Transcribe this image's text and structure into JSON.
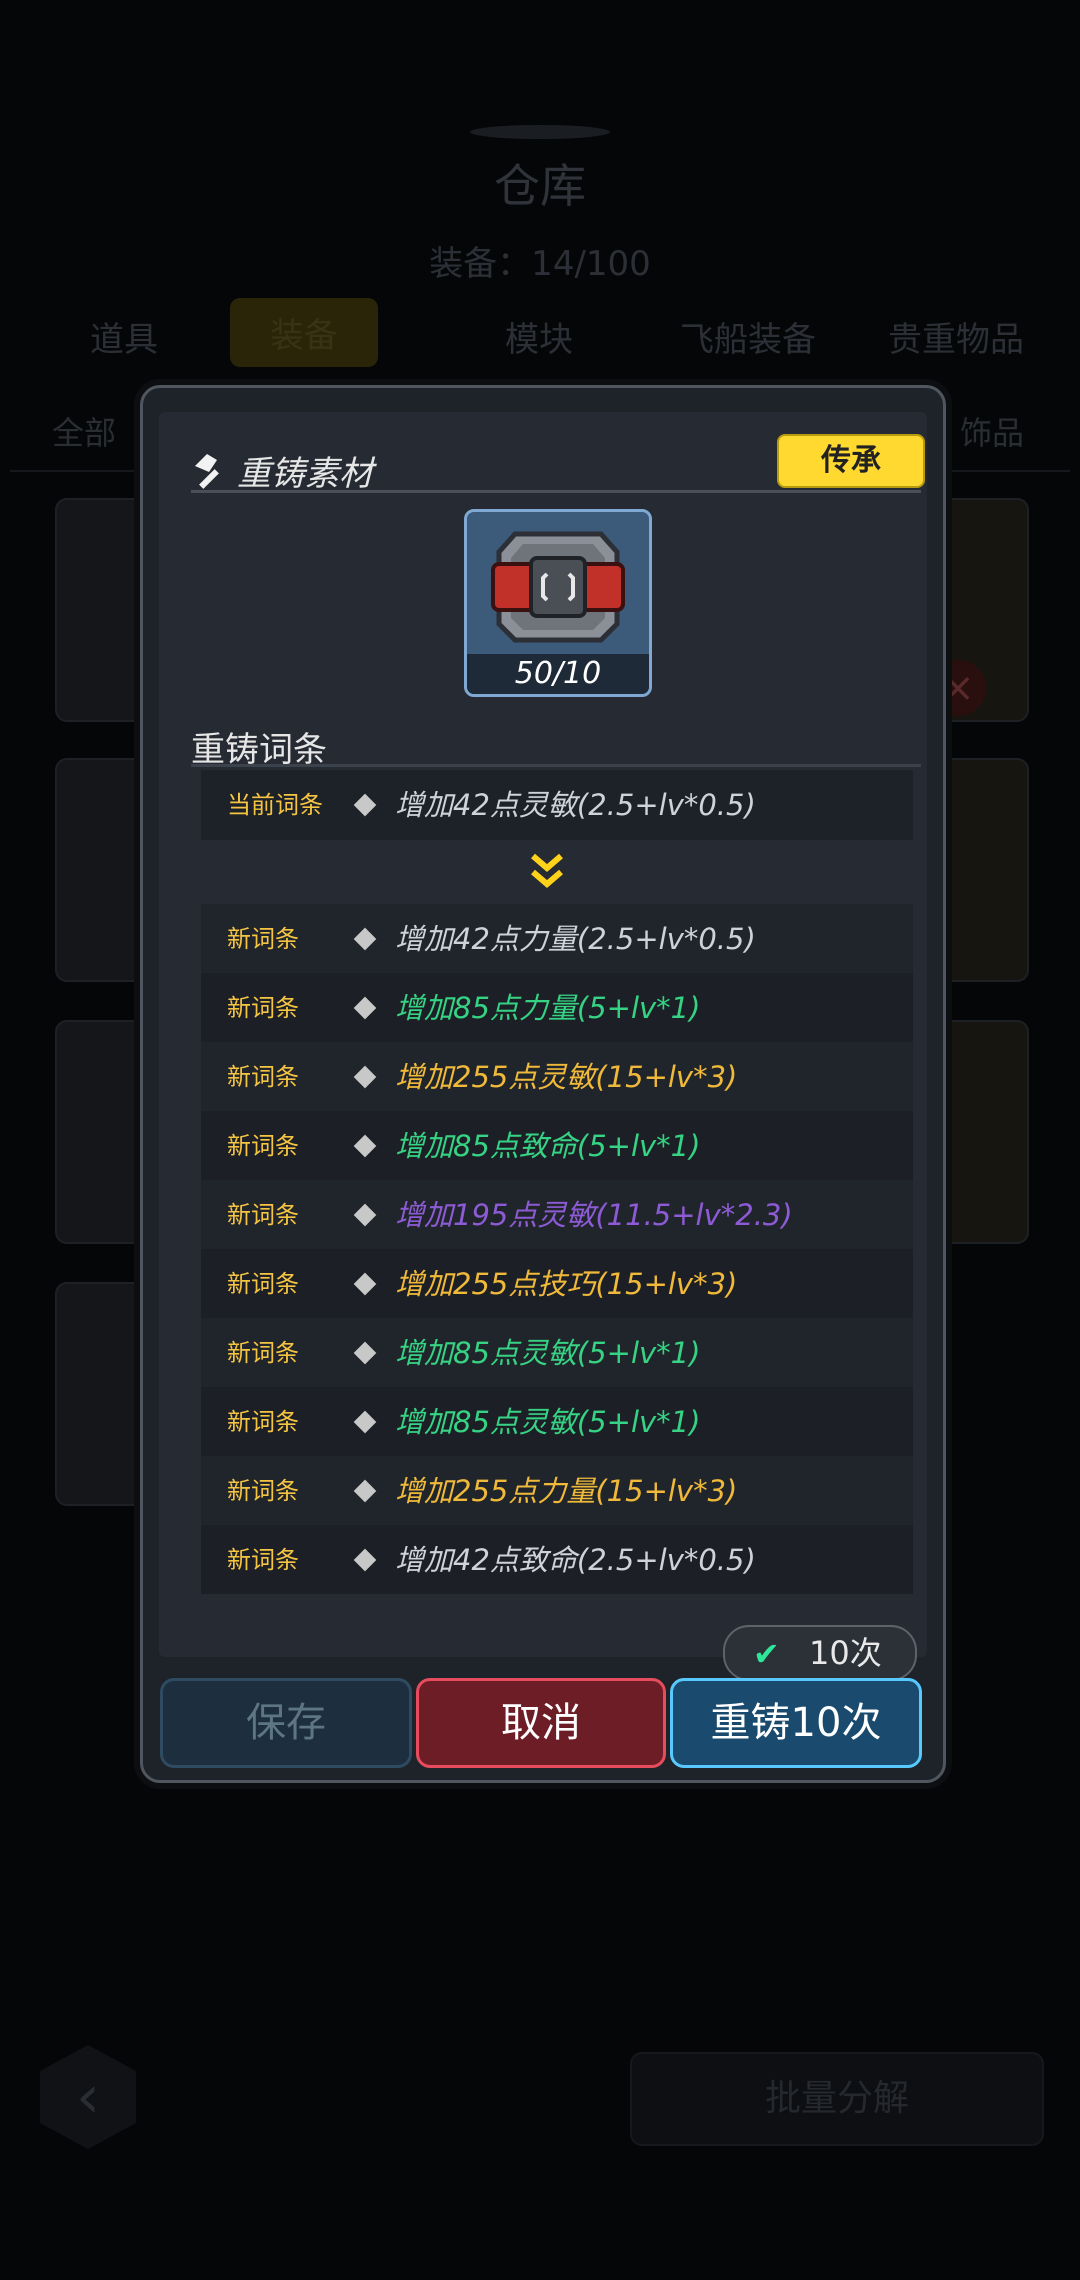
{
  "background": {
    "title": "仓库",
    "capacity": "装备：14/100",
    "tabs": [
      "道具",
      "装备",
      "模块",
      "飞船装备",
      "贵重物品"
    ],
    "subtabs": {
      "left": "全部",
      "right": "饰品"
    },
    "batch_button": "批量分解"
  },
  "modal": {
    "header_title": "重铸素材",
    "inherit_button": "传承",
    "material": {
      "icon": "reforge-chip-icon",
      "count": "50/10"
    },
    "section_title": "重铸词条",
    "current": {
      "label": "当前词条",
      "text": "增加42点灵敏(2.5+lv*0.5)",
      "color": "#cfd2d6"
    },
    "new_entries": [
      {
        "label": "新词条",
        "text": "增加42点力量(2.5+lv*0.5)",
        "color": "white"
      },
      {
        "label": "新词条",
        "text": "增加85点力量(5+lv*1)",
        "color": "green"
      },
      {
        "label": "新词条",
        "text": "增加255点灵敏(15+lv*3)",
        "color": "gold"
      },
      {
        "label": "新词条",
        "text": "增加85点致命(5+lv*1)",
        "color": "green"
      },
      {
        "label": "新词条",
        "text": "增加195点灵敏(11.5+lv*2.3)",
        "color": "purple"
      },
      {
        "label": "新词条",
        "text": "增加255点技巧(15+lv*3)",
        "color": "gold"
      },
      {
        "label": "新词条",
        "text": "增加85点灵敏(5+lv*1)",
        "color": "green"
      },
      {
        "label": "新词条",
        "text": "增加85点灵敏(5+lv*1)",
        "color": "green"
      },
      {
        "label": "新词条",
        "text": "增加255点力量(15+lv*3)",
        "color": "gold"
      },
      {
        "label": "新词条",
        "text": "增加42点致命(2.5+lv*0.5)",
        "color": "white"
      }
    ],
    "count_toggle": "10次",
    "buttons": {
      "save": "保存",
      "cancel": "取消",
      "reforge": "重铸10次"
    }
  }
}
